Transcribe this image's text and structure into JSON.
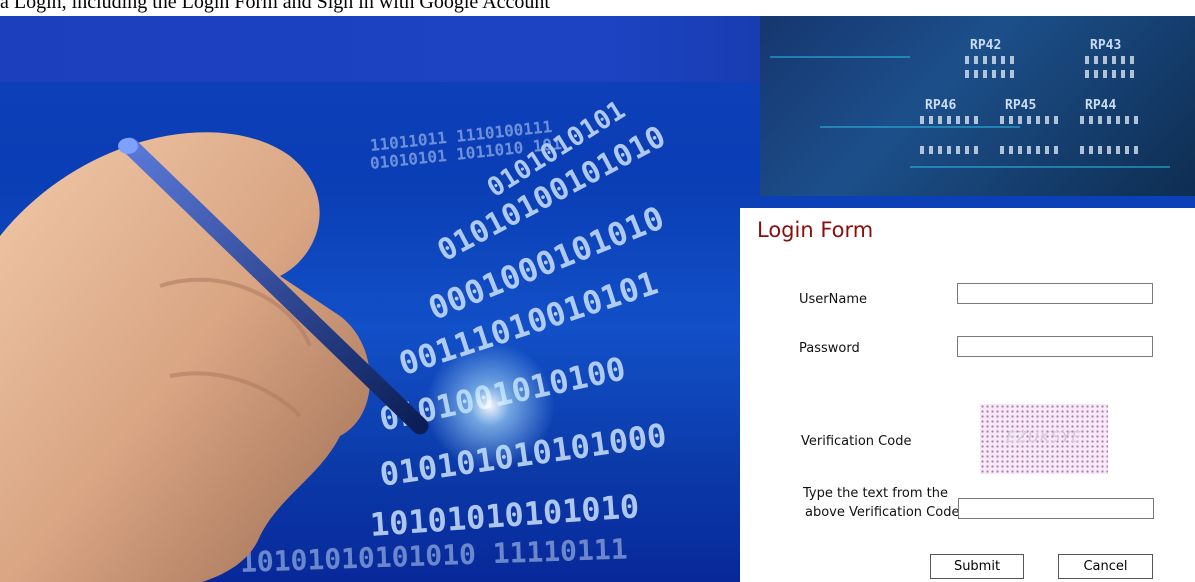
{
  "top_strip": {
    "text": "a Login, including the Login Form and Sign in with Google Account"
  },
  "banner": {
    "circuit_labels": [
      "RP42",
      "RP43",
      "RP46",
      "RP45",
      "RP44"
    ]
  },
  "form": {
    "title": "Login Form",
    "username_label": "UserName",
    "username_value": "",
    "password_label": "Password",
    "password_value": "",
    "verification_label": "Verification Code",
    "captcha_text": "EZUKSYE",
    "captcha_input_label_line1": "Type the text from the",
    "captcha_input_label_line2": "above Verification Code",
    "captcha_input_value": "",
    "submit_label": "Submit",
    "cancel_label": "Cancel"
  }
}
